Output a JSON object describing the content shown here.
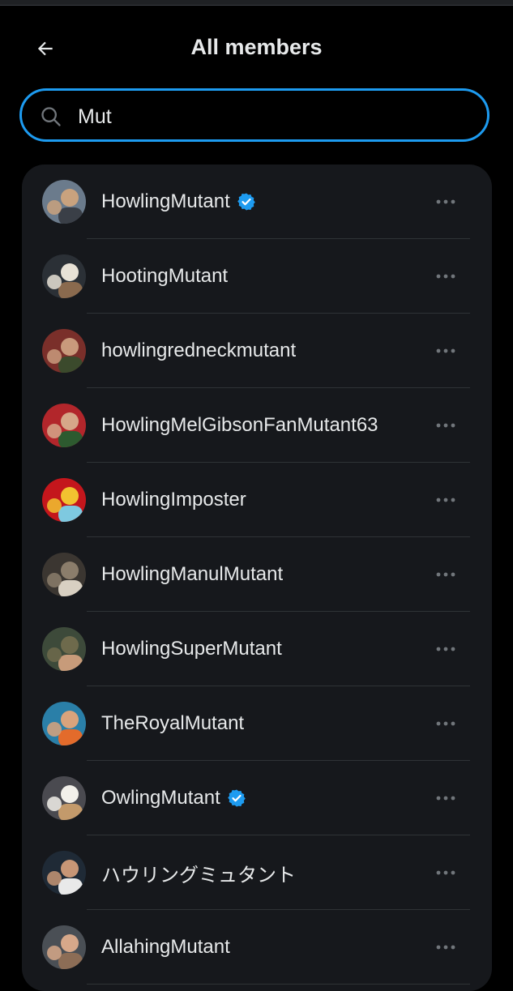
{
  "header": {
    "title": "All members",
    "back_icon": "arrow-left-icon"
  },
  "search": {
    "icon": "search-icon",
    "value": "Mut"
  },
  "colors": {
    "background": "#000000",
    "card": "#16181c",
    "accent": "#1d9bf0",
    "text": "#e7e9ea",
    "muted": "#71767b",
    "divider": "#2f3336"
  },
  "members": [
    {
      "name": "HowlingMutant",
      "verified": true,
      "avatar_colors": [
        "#6b7b8c",
        "#c9a27e",
        "#3a3f47"
      ]
    },
    {
      "name": "HootingMutant",
      "verified": false,
      "avatar_colors": [
        "#2b3036",
        "#e8e2d6",
        "#8a6a4e"
      ]
    },
    {
      "name": "howlingredneckmutant",
      "verified": false,
      "avatar_colors": [
        "#7a2f2a",
        "#c99a7c",
        "#3b4a2c"
      ]
    },
    {
      "name": "HowlingMelGibsonFanMutant63",
      "verified": false,
      "avatar_colors": [
        "#b2262b",
        "#d6a789",
        "#2d5a2f"
      ]
    },
    {
      "name": "HowlingImposter",
      "verified": false,
      "avatar_colors": [
        "#c4161c",
        "#f2c230",
        "#7ec9e0"
      ]
    },
    {
      "name": "HowlingManulMutant",
      "verified": false,
      "avatar_colors": [
        "#3b3631",
        "#8b7d6b",
        "#d8d0c2"
      ]
    },
    {
      "name": "HowlingSuperMutant",
      "verified": false,
      "avatar_colors": [
        "#3d4a3a",
        "#6e6a4c",
        "#c79b7a"
      ]
    },
    {
      "name": "TheRoyalMutant",
      "verified": false,
      "avatar_colors": [
        "#2a7fa8",
        "#d9a37c",
        "#e36b2b"
      ]
    },
    {
      "name": "OwlingMutant",
      "verified": true,
      "avatar_colors": [
        "#4a4a50",
        "#f2f0ea",
        "#c39a6b"
      ]
    },
    {
      "name": "ハウリングミュタント",
      "verified": false,
      "avatar_colors": [
        "#1f2a36",
        "#c79676",
        "#e9e9e9"
      ]
    },
    {
      "name": "AllahingMutant",
      "verified": false,
      "avatar_colors": [
        "#4a4f55",
        "#d7a88a",
        "#8c6d56"
      ]
    }
  ],
  "row_more_icon": "more-horizontal-icon",
  "verified_icon": "verified-badge-icon"
}
